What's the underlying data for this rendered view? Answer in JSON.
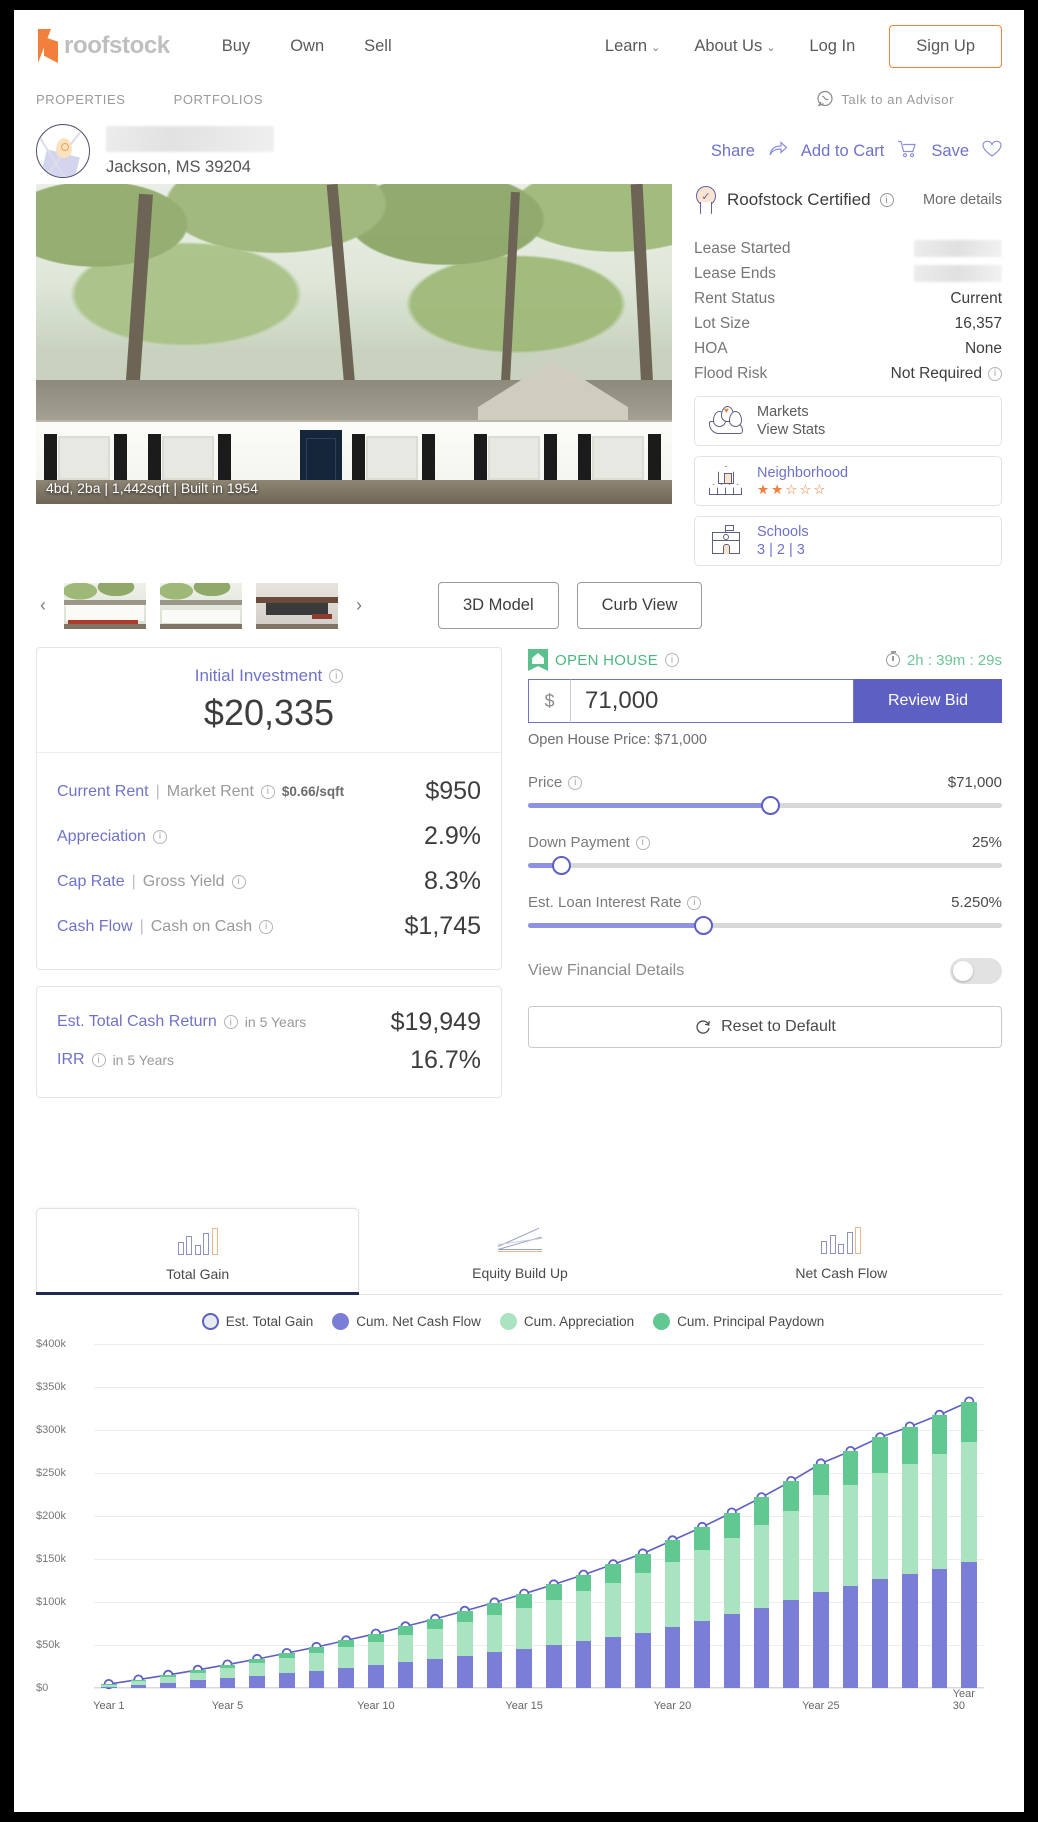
{
  "nav": {
    "logo_text": "roofstock",
    "main_links": [
      "Buy",
      "Own",
      "Sell"
    ],
    "right_links": [
      {
        "label": "Learn",
        "caret": true
      },
      {
        "label": "About Us",
        "caret": true
      },
      {
        "label": "Log In",
        "caret": false
      }
    ],
    "signup_label": "Sign Up",
    "brand_color": "#f0803c"
  },
  "subnav": {
    "items": [
      "PROPERTIES",
      "PORTFOLIOS"
    ],
    "advisor_label": "Talk to an Advisor"
  },
  "property": {
    "address_line1": "",
    "city_state_zip": "Jackson, MS 39204",
    "actions": [
      {
        "label": "Share",
        "icon": "share-icon"
      },
      {
        "label": "Add to Cart",
        "icon": "cart-icon"
      },
      {
        "label": "Save",
        "icon": "heart-icon"
      }
    ],
    "hero_caption": "4bd, 2ba | 1,442sqft | Built in 1954"
  },
  "details": {
    "certified_label": "Roofstock Certified",
    "more_details_label": "More details",
    "rows": [
      {
        "label": "Lease Started",
        "value": "",
        "redacted": true,
        "info": false
      },
      {
        "label": "Lease Ends",
        "value": "",
        "redacted": true,
        "info": false
      },
      {
        "label": "Rent Status",
        "value": "Current",
        "redacted": false,
        "info": false
      },
      {
        "label": "Lot Size",
        "value": "16,357",
        "redacted": false,
        "info": false
      },
      {
        "label": "HOA",
        "value": "None",
        "redacted": false,
        "info": false
      },
      {
        "label": "Flood Risk",
        "value": "Not Required",
        "redacted": false,
        "info": true
      }
    ],
    "cards": [
      {
        "icon": "markets-icon",
        "title": "Markets",
        "subtitle": "View Stats",
        "link": false,
        "stars": 0
      },
      {
        "icon": "neighborhood-icon",
        "title": "Neighborhood",
        "subtitle": "",
        "link": true,
        "stars": 2
      },
      {
        "icon": "schools-icon",
        "title": "Schools",
        "subtitle": "3 | 2 | 3",
        "link": true,
        "stars": 0
      }
    ]
  },
  "gallery": {
    "prev_label": "‹",
    "next_label": "›",
    "view_buttons": [
      "3D Model",
      "Curb View"
    ]
  },
  "investment": {
    "title": "Initial Investment",
    "amount": "$20,335",
    "metrics": [
      {
        "key": "Current Rent",
        "sep": "|",
        "sub": "Market Rent",
        "note": "$0.66/sqft",
        "value": "$950"
      },
      {
        "key": "Appreciation",
        "sep": "",
        "sub": "",
        "note": "",
        "value": "2.9%"
      },
      {
        "key": "Cap Rate",
        "sep": "|",
        "sub": "Gross Yield",
        "note": "",
        "value": "8.3%"
      },
      {
        "key": "Cash Flow",
        "sep": "|",
        "sub": "Cash on Cash",
        "note": "",
        "value": "$1,745"
      }
    ],
    "returns": [
      {
        "key": "Est. Total Cash Return",
        "note": "in 5 Years",
        "value": "$19,949"
      },
      {
        "key": "IRR",
        "note": "in 5 Years",
        "value": "16.7%"
      }
    ]
  },
  "bid": {
    "open_house_label": "OPEN HOUSE",
    "timer": "2h : 39m : 29s",
    "currency_symbol": "$",
    "amount": "71,000",
    "placeholder": "71,000",
    "review_label": "Review Bid",
    "open_house_price": "Open House Price: $71,000",
    "sliders": [
      {
        "label": "Price",
        "value": "$71,000",
        "pct": 51
      },
      {
        "label": "Down Payment",
        "value": "25%",
        "pct": 7
      },
      {
        "label": "Est. Loan Interest Rate",
        "value": "5.250%",
        "pct": 37
      }
    ],
    "financial_details_label": "View Financial Details",
    "financial_details_on": false,
    "reset_label": "Reset to Default"
  },
  "tabs": [
    {
      "label": "Total Gain",
      "icon": "bar-chart-icon",
      "active": true
    },
    {
      "label": "Equity Build Up",
      "icon": "line-chart-icon",
      "active": false
    },
    {
      "label": "Net Cash Flow",
      "icon": "bar-chart-icon",
      "active": false
    }
  ],
  "chart_data": {
    "type": "bar",
    "title": "",
    "xlabel": "",
    "ylabel": "",
    "ylim": [
      0,
      400000
    ],
    "grid": true,
    "legend_position": "top",
    "y_ticks": [
      "$0",
      "$50k",
      "$100k",
      "$150k",
      "$200k",
      "$250k",
      "$300k",
      "$350k",
      "$400k"
    ],
    "y_tick_values": [
      0,
      50000,
      100000,
      150000,
      200000,
      250000,
      300000,
      350000,
      400000
    ],
    "x_tick_labels": [
      "Year 1",
      "Year 5",
      "Year 10",
      "Year 15",
      "Year 20",
      "Year 25",
      "Year 30"
    ],
    "x_tick_indices": [
      0,
      4,
      9,
      14,
      19,
      24,
      29
    ],
    "categories": [
      "Year 1",
      "Year 2",
      "Year 3",
      "Year 4",
      "Year 5",
      "Year 6",
      "Year 7",
      "Year 8",
      "Year 9",
      "Year 10",
      "Year 11",
      "Year 12",
      "Year 13",
      "Year 14",
      "Year 15",
      "Year 16",
      "Year 17",
      "Year 18",
      "Year 19",
      "Year 20",
      "Year 21",
      "Year 22",
      "Year 23",
      "Year 24",
      "Year 25",
      "Year 26",
      "Year 27",
      "Year 28",
      "Year 29",
      "Year 30"
    ],
    "legend": [
      {
        "name": "Est. Total Gain",
        "color": "#e8eaf2",
        "border": "#5e5fc3",
        "marker": "circle-outline"
      },
      {
        "name": "Cum. Net Cash Flow",
        "color": "#7b7ed6",
        "marker": "circle"
      },
      {
        "name": "Cum. Appreciation",
        "color": "#a9e3c0",
        "marker": "circle"
      },
      {
        "name": "Cum. Principal Paydown",
        "color": "#62c892",
        "marker": "circle"
      }
    ],
    "series": [
      {
        "name": "Cum. Net Cash Flow",
        "type": "bar",
        "color": "#7b7ed6",
        "values": [
          1745,
          4000,
          6400,
          8900,
          11500,
          14300,
          17200,
          20200,
          23400,
          26700,
          30200,
          33800,
          37600,
          41500,
          45600,
          49900,
          54400,
          59100,
          64000,
          71000,
          78000,
          85500,
          93500,
          102000,
          111500,
          118500,
          126500,
          132000,
          138500,
          146000
        ]
      },
      {
        "name": "Cum. Appreciation",
        "type": "bar",
        "color": "#a9e3c0",
        "values": [
          2100,
          4300,
          6600,
          9100,
          11700,
          14500,
          17400,
          20500,
          23800,
          27200,
          30900,
          34800,
          38900,
          43300,
          47900,
          52800,
          58000,
          63500,
          69300,
          75500,
          82000,
          89000,
          96400,
          104200,
          112500,
          118000,
          124000,
          129000,
          134000,
          140000
        ]
      },
      {
        "name": "Cum. Principal Paydown",
        "type": "bar",
        "color": "#62c892",
        "values": [
          700,
          1450,
          2250,
          3100,
          4000,
          4950,
          5950,
          7000,
          8100,
          9250,
          10500,
          11800,
          13150,
          14600,
          16100,
          17700,
          19400,
          21200,
          23100,
          25100,
          27200,
          29500,
          31900,
          34400,
          37000,
          39000,
          41000,
          43000,
          45000,
          47000
        ]
      },
      {
        "name": "Est. Total Gain",
        "type": "line",
        "color": "#5e5fc3",
        "values": [
          4545,
          9750,
          15250,
          21100,
          27200,
          33750,
          40550,
          47700,
          55300,
          63150,
          71600,
          80400,
          89650,
          99400,
          109600,
          120400,
          131800,
          143800,
          156400,
          171600,
          187200,
          204000,
          221800,
          240600,
          261000,
          275500,
          291500,
          304000,
          317500,
          333000
        ]
      }
    ]
  }
}
